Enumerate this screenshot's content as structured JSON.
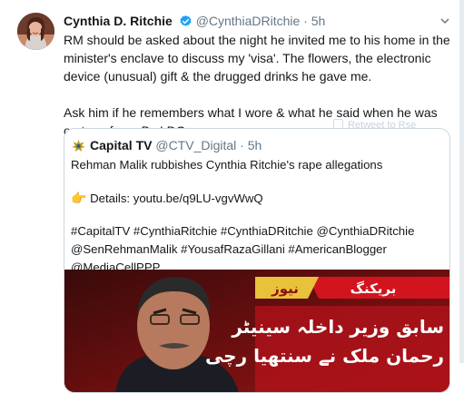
{
  "tweet": {
    "author_name": "Cynthia D. Ritchie",
    "author_handle": "@CynthiaDRitchie",
    "separator": "·",
    "time": "5h",
    "avatar_icon": "user-avatar",
    "verified_icon": "verified-badge-icon",
    "caret_icon": "chevron-down-icon",
    "paragraphs": [
      "RM should be asked about the night he invited me to his home in the minister's enclave to discuss my 'visa'. The flowers, the electronic device (unusual) gift & the drugged drinks he gave me.",
      "Ask him if he remembers what I wore & what he said when he was on top of me. Bc I DO."
    ],
    "overlay_ghost_text": "Retweet to Rse"
  },
  "quoted": {
    "logo_icon": "capital-tv-logo",
    "name": "Capital TV",
    "handle": "@CTV_Digital",
    "separator": "·",
    "time": "5h",
    "headline": "Rehman Malik rubbishes Cynthia Ritchie's rape allegations",
    "pointer_emoji": "👉",
    "details": "Details: youtu.be/q9LU-vgvWwQ",
    "hashtags": "#CapitalTV #CynthiaRitchie #CynthiaDRitchie @CynthiaDRitchie @SenRehmanMalik #YousafRazaGillani #AmericanBlogger @MediaCellPPP",
    "image": {
      "banner_left": "بریکنگ",
      "banner_right": "نیوز",
      "urdu_line1": "سابق وزیر داخلہ سینیٹر",
      "urdu_line2": "رحمان ملک نے سنتھیا رچی"
    }
  },
  "colors": {
    "text": "#14171a",
    "muted": "#657786",
    "verified": "#1da1f2",
    "border": "#ccd6dd",
    "news_red": "#b3131b"
  }
}
